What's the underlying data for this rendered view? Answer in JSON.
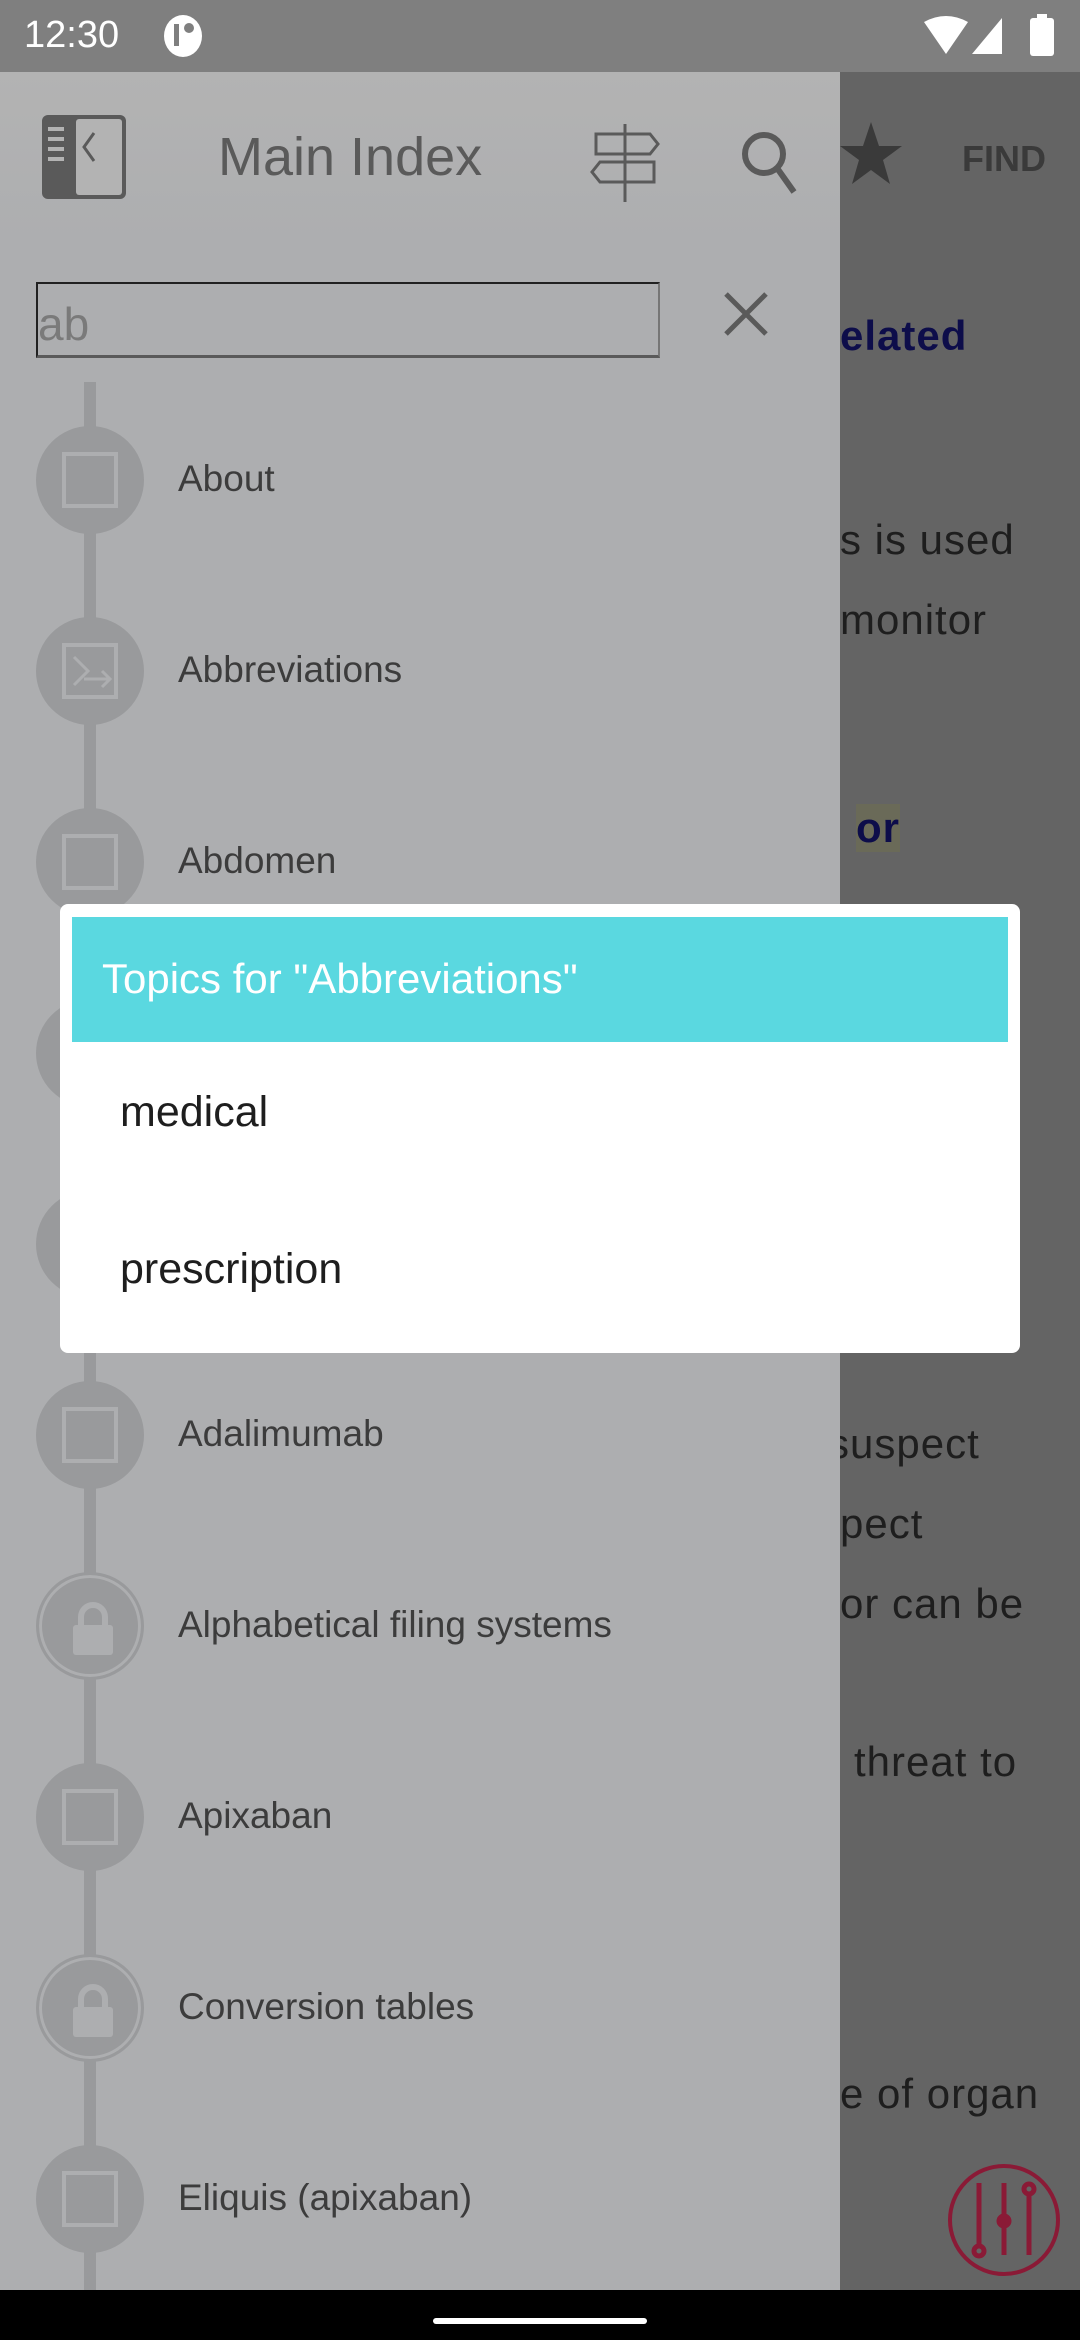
{
  "status_bar": {
    "time": "12:30"
  },
  "header": {
    "title": "Main Index",
    "find_label": "FIND"
  },
  "search": {
    "value": "ab"
  },
  "list": [
    {
      "label": "About",
      "icon": "square-icon"
    },
    {
      "label": "Abbreviations",
      "icon": "abbreviation-icon"
    },
    {
      "label": "Abdomen",
      "icon": "square-icon"
    },
    {
      "label": "",
      "icon": "square-icon"
    },
    {
      "label": "",
      "icon": "square-icon"
    },
    {
      "label": "Adalimumab",
      "icon": "square-icon"
    },
    {
      "label": "Alphabetical filing systems",
      "icon": "lock-icon"
    },
    {
      "label": "Apixaban",
      "icon": "square-icon"
    },
    {
      "label": "Conversion tables",
      "icon": "lock-icon"
    },
    {
      "label": "Eliquis (apixaban)",
      "icon": "square-icon"
    }
  ],
  "background_content": [
    "elated",
    "s is used",
    "monitor",
    "or",
    "suspect",
    "pect",
    "or can be",
    "threat to",
    "e of organ"
  ],
  "dialog": {
    "title": "Topics for \"Abbreviations\"",
    "items": [
      "medical",
      "prescription"
    ]
  },
  "colors": {
    "dialog_header": "#5ad8e0",
    "fab": "#8a1a36",
    "link": "#0d0d4a"
  }
}
